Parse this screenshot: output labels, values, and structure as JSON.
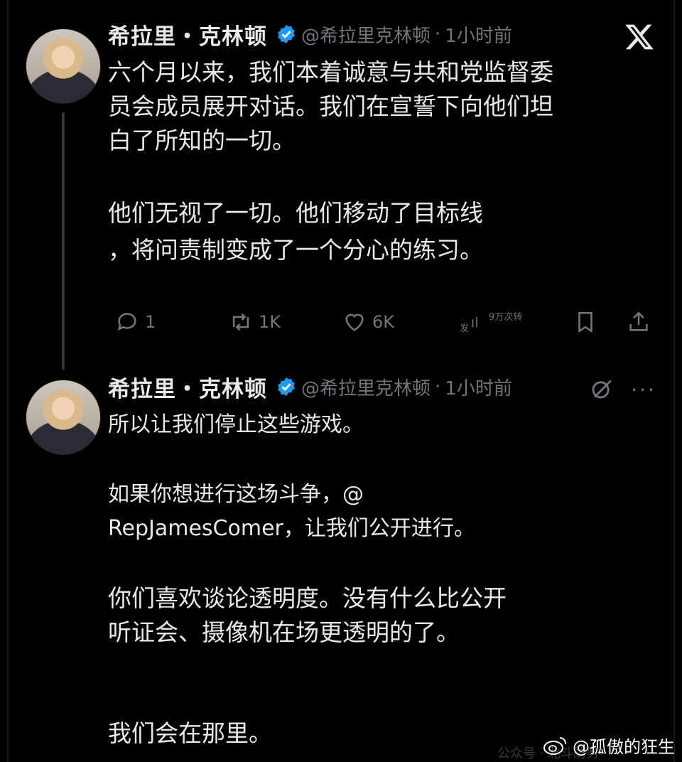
{
  "tweets": [
    {
      "name": "希拉里・克林顿",
      "handle": "@希拉里克林顿",
      "time": "1小时前",
      "lines": [
        "六个月以来，我们本着诚意与共和党监督委",
        "员会成员展开对话。我们在宣誓下向他们坦",
        "白了所知的一切。",
        "他们无视了一切。他们移动了目标线",
        "，将问责制变成了一个分心的练习。"
      ],
      "actions": {
        "replies": "1",
        "retweets": "1K",
        "likes": "6K",
        "views_prefix": "发",
        "views": "9万次转"
      }
    },
    {
      "name": "希拉里・克林顿",
      "handle": "@希拉里克林顿",
      "time": "1小时前",
      "lines": [
        "所以让我们停止这些游戏。",
        "如果你想进行这场斗争，@",
        "RepJamesComer，让我们公开进行。",
        "你们喜欢谈论透明度。没有什么比公开",
        "听证会、摄像机在场更透明的了。",
        "我们会在那里。"
      ],
      "more_label": "···"
    }
  ],
  "separator": "·",
  "watermark": "@孤傲的狂生",
  "watermark_sub": "公众号 · 北斗防务",
  "colors": {
    "background": "#000000",
    "text": "#e7e9ea",
    "muted": "#71767b",
    "verified": "#1d9bf0"
  },
  "icons": [
    "x-logo-icon",
    "verified-badge-icon",
    "reply-icon",
    "retweet-icon",
    "like-icon",
    "views-icon",
    "bookmark-icon",
    "share-icon",
    "grok-icon",
    "more-icon",
    "weibo-logo-icon"
  ]
}
